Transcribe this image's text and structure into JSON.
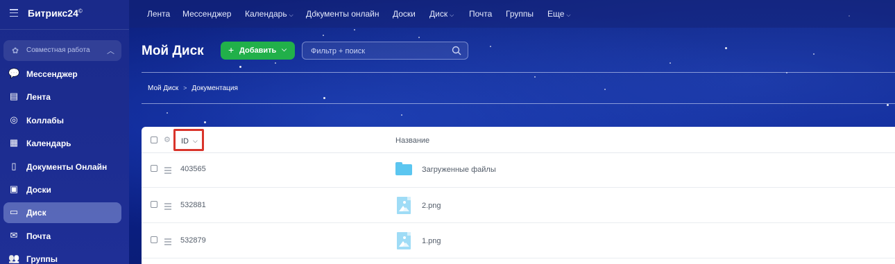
{
  "brand": {
    "name": "Битрикс24",
    "mark": "©"
  },
  "topnav": [
    {
      "label": "Лента",
      "chevron": false
    },
    {
      "label": "Мессенджер",
      "chevron": false
    },
    {
      "label": "Календарь",
      "chevron": true
    },
    {
      "label": "Документы онлайн",
      "chevron": false
    },
    {
      "label": "Доски",
      "chevron": false
    },
    {
      "label": "Диск",
      "chevron": true
    },
    {
      "label": "Почта",
      "chevron": false
    },
    {
      "label": "Группы",
      "chevron": false
    },
    {
      "label": "Еще",
      "chevron": true
    }
  ],
  "sidebar": {
    "group_label": "Совместная работа",
    "items": [
      {
        "label": "Мессенджер",
        "icon": "chat-icon",
        "active": false
      },
      {
        "label": "Лента",
        "icon": "feed-icon",
        "active": false
      },
      {
        "label": "Коллабы",
        "icon": "collab-icon",
        "active": false
      },
      {
        "label": "Календарь",
        "icon": "calendar-icon",
        "active": false
      },
      {
        "label": "Документы Онлайн",
        "icon": "document-icon",
        "active": false
      },
      {
        "label": "Доски",
        "icon": "board-icon",
        "active": false
      },
      {
        "label": "Диск",
        "icon": "disk-icon",
        "active": true
      },
      {
        "label": "Почта",
        "icon": "mail-icon",
        "active": false
      },
      {
        "label": "Группы",
        "icon": "groups-icon",
        "active": false
      }
    ]
  },
  "header": {
    "title": "Мой Диск",
    "add_button": "Добавить",
    "search_placeholder": "Фильтр + поиск"
  },
  "breadcrumbs": [
    "Мой Диск",
    "Документация"
  ],
  "table": {
    "columns": {
      "id": "ID",
      "name": "Название"
    },
    "rows": [
      {
        "id": "403565",
        "name": "Загруженные файлы",
        "type": "folder"
      },
      {
        "id": "532881",
        "name": "2.png",
        "type": "image"
      },
      {
        "id": "532879",
        "name": "1.png",
        "type": "image"
      }
    ]
  },
  "colors": {
    "accent_green": "#21b04a",
    "highlight_red": "#d9342b",
    "folder_blue": "#5bc6f0"
  }
}
